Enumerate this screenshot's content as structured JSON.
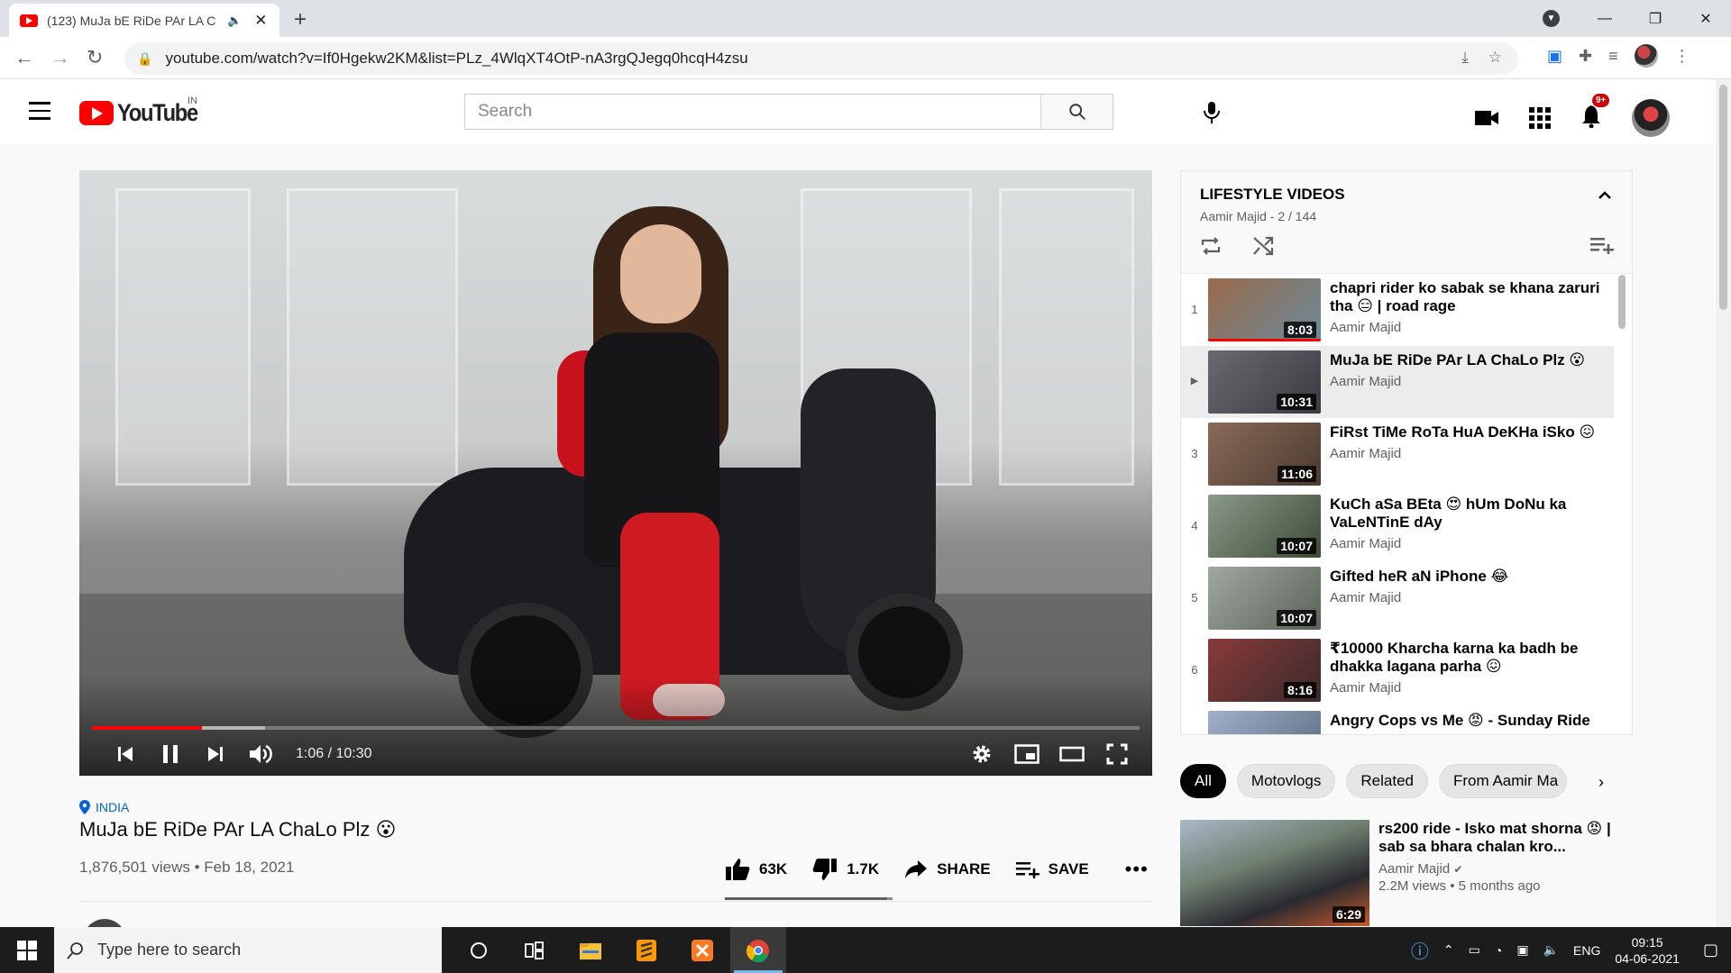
{
  "browser": {
    "tab_title": "(123) MuJa bE RiDe PAr LA C",
    "tab_audio_icon": "speaker-icon",
    "url": "youtube.com/watch?v=If0Hgekw2KM&list=PLz_4WlqXT4OtP-nA3rgQJegq0hcqH4zsu"
  },
  "header": {
    "logo_text": "YouTube",
    "country": "IN",
    "search_placeholder": "Search",
    "notification_count": "9+"
  },
  "player": {
    "time": "1:06 / 10:30",
    "progress_fraction": 0.105,
    "buffered_fraction": 0.165
  },
  "video": {
    "location": "INDIA",
    "title": "MuJa bE RiDe PAr LA ChaLo Plz 😮",
    "meta": "1,876,501 views • Feb 18, 2021",
    "likes": "63K",
    "dislikes": "1.7K",
    "share_label": "SHARE",
    "save_label": "SAVE",
    "like_ratio": 0.97
  },
  "playlist": {
    "title": "LIFESTYLE VIDEOS",
    "subtitle": "Aamir Majid - 2 / 144",
    "items": [
      {
        "index": "1",
        "title": "chapri rider ko sabak se khana zaruri tha 😑 | road rage",
        "channel": "Aamir Majid",
        "duration": "8:03",
        "thumb": "#8a6a4a"
      },
      {
        "index": "▶",
        "title": "MuJa bE RiDe PAr LA ChaLo Plz 😮",
        "channel": "Aamir Majid",
        "duration": "10:31",
        "thumb": "#4a4a50"
      },
      {
        "index": "3",
        "title": "FiRst TiMe RoTa HuA DeKHa iSko 😖",
        "channel": "Aamir Majid",
        "duration": "11:06",
        "thumb": "#7a5a48"
      },
      {
        "index": "4",
        "title": "KuCh aSa BEta 😍 hUm DoNu ka VaLeNTinE dAy",
        "channel": "Aamir Majid",
        "duration": "10:07",
        "thumb": "#5e6a58"
      },
      {
        "index": "5",
        "title": "Gifted heR aN iPhone 😂",
        "channel": "Aamir Majid",
        "duration": "10:07",
        "thumb": "#6f7670"
      },
      {
        "index": "6",
        "title": "₹10000 Kharcha karna ka badh be dhakka lagana parha 😖",
        "channel": "Aamir Majid",
        "duration": "8:16",
        "thumb": "#5a3a3a"
      },
      {
        "index": "",
        "title": "Angry Cops vs Me 😡 - Sunday Ride",
        "channel": "",
        "duration": "",
        "thumb": "#7f8fa0"
      }
    ]
  },
  "chips": [
    "All",
    "Motovlogs",
    "Related",
    "From Aamir Ma"
  ],
  "recommendation": {
    "title": "rs200 ride - Isko mat shorna 😡 | sab sa bhara chalan kro...",
    "channel": "Aamir Majid",
    "meta": "2.2M views • 5 months ago",
    "duration": "6:29"
  },
  "taskbar": {
    "search_placeholder": "Type here to search",
    "language": "ENG",
    "time": "09:15",
    "date": "04-06-2021"
  },
  "colors": {
    "brand_red": "#ff0000",
    "link_blue": "#065fd4"
  }
}
